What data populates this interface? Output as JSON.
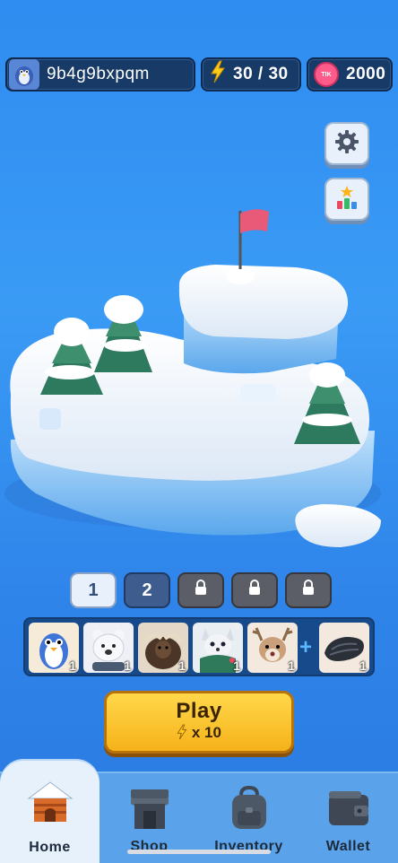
{
  "header": {
    "username": "9b4g9bxpqm",
    "energy": "30 / 30",
    "tik_balance": "2000",
    "tik_coin_label": "TIK"
  },
  "side_buttons": [
    "gear-icon",
    "leaderboard-icon"
  ],
  "levels": [
    {
      "label": "1",
      "state": "current"
    },
    {
      "label": "2",
      "state": "open"
    },
    {
      "label": "",
      "state": "locked"
    },
    {
      "label": "",
      "state": "locked"
    },
    {
      "label": "",
      "state": "locked"
    }
  ],
  "team": [
    {
      "name": "penguin",
      "count": "1"
    },
    {
      "name": "polar-bear",
      "count": "1"
    },
    {
      "name": "musk-ox",
      "count": "1"
    },
    {
      "name": "arctic-fox",
      "count": "1"
    },
    {
      "name": "reindeer",
      "count": "1"
    },
    {
      "name": "sled-item",
      "count": "1"
    }
  ],
  "play": {
    "label": "Play",
    "cost": "x 10"
  },
  "nav": [
    {
      "label": "Home",
      "active": true
    },
    {
      "label": "Shop",
      "active": false
    },
    {
      "label": "Inventory",
      "active": false
    },
    {
      "label": "Wallet",
      "active": false
    }
  ],
  "colors": {
    "accent": "#f6b21a",
    "panel": "#173a66",
    "background": "#2f8cf0"
  }
}
